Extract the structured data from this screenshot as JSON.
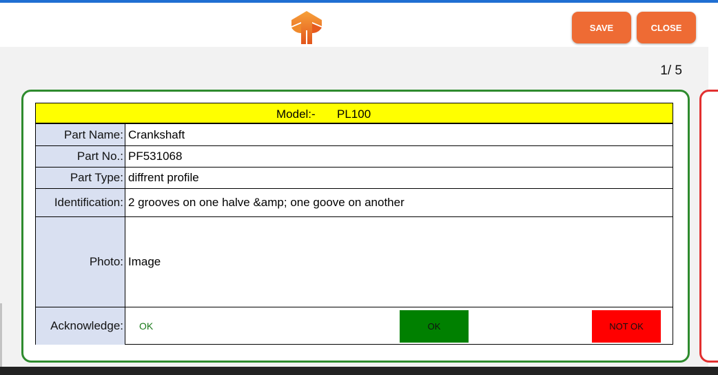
{
  "header": {
    "logo_icon": "brand-logo-icon",
    "save_label": "SAVE",
    "close_label": "CLOSE",
    "accent": "#ee6b34"
  },
  "pager": {
    "text": "1/ 5"
  },
  "card": {
    "border_color": "#2e8b2e",
    "model_label": "Model:-",
    "model_value": "PL100",
    "rows": [
      {
        "label": "Part Name:",
        "value": "Crankshaft"
      },
      {
        "label": "Part No.:",
        "value": "PF531068"
      },
      {
        "label": "Part Type:",
        "value": "diffrent profile"
      },
      {
        "label": "Identification:",
        "value": "2 grooves on one halve &amp; one goove on another"
      },
      {
        "label": "Photo:",
        "value": "Image"
      }
    ],
    "acknowledge": {
      "label": "Acknowledge:",
      "current": "OK",
      "ok_label": "OK",
      "not_ok_label": "NOT OK",
      "ok_color": "#008000",
      "not_ok_color": "#ff0000"
    }
  },
  "next_card": {
    "border_color": "#e23030"
  }
}
